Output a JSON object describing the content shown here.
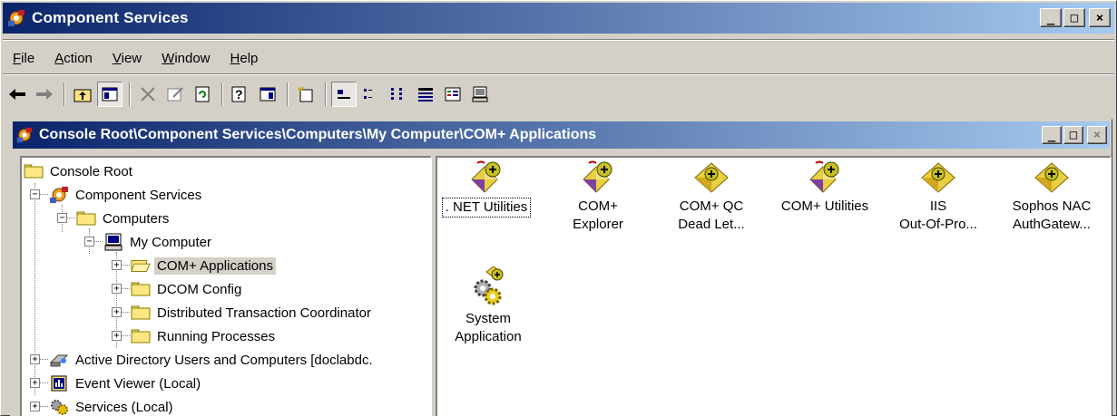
{
  "app": {
    "title": "Component Services"
  },
  "window_buttons": {
    "minimize": "_",
    "maximize": "□",
    "close": "×"
  },
  "menu": [
    {
      "label": "File",
      "key": "F",
      "rest": "ile"
    },
    {
      "label": "Action",
      "key": "A",
      "rest": "ction"
    },
    {
      "label": "View",
      "key": "V",
      "rest": "iew"
    },
    {
      "label": "Window",
      "key": "W",
      "rest": "indow"
    },
    {
      "label": "Help",
      "key": "H",
      "rest": "elp"
    }
  ],
  "toolbar": [
    "back-icon",
    "forward-icon",
    "up-folder-icon",
    "show-hide-tree-icon",
    "delete-icon",
    "properties-icon",
    "refresh-icon",
    "help-icon",
    "show-hide-action-pane-icon",
    "new-icon",
    "large-icons-icon",
    "small-icons-icon",
    "list-view-icon",
    "detail-view-icon",
    "status-view-icon",
    "computer-icon"
  ],
  "mdi": {
    "title": "Console Root\\Component Services\\Computers\\My Computer\\COM+ Applications"
  },
  "tree": [
    {
      "label": "Console Root",
      "icon": "folder-icon",
      "depth": 0
    },
    {
      "label": "Component Services",
      "icon": "component-services-icon",
      "depth": 1,
      "expander": "minus"
    },
    {
      "label": "Computers",
      "icon": "folder-icon",
      "depth": 2,
      "expander": "minus"
    },
    {
      "label": "My Computer",
      "icon": "computer-icon",
      "depth": 3,
      "expander": "minus"
    },
    {
      "label": "COM+ Applications",
      "icon": "open-folder-icon",
      "depth": 4,
      "expander": "plus",
      "selected": true
    },
    {
      "label": "DCOM Config",
      "icon": "folder-icon",
      "depth": 4,
      "expander": "plus"
    },
    {
      "label": "Distributed Transaction Coordinator",
      "icon": "folder-icon",
      "depth": 4,
      "expander": "plus"
    },
    {
      "label": "Running Processes",
      "icon": "folder-icon",
      "depth": 4,
      "expander": "plus"
    },
    {
      "label": "Active Directory Users and Computers [doclabdc.",
      "icon": "active-directory-icon",
      "depth": 1,
      "expander": "plus"
    },
    {
      "label": "Event Viewer (Local)",
      "icon": "event-viewer-icon",
      "depth": 1,
      "expander": "plus"
    },
    {
      "label": "Services (Local)",
      "icon": "services-icon",
      "depth": 1,
      "expander": "plus"
    }
  ],
  "apps": [
    {
      "line1": ". NET Utilities",
      "line2": "",
      "icon": "com-app-running-icon",
      "focused": true
    },
    {
      "line1": "COM+",
      "line2": "Explorer",
      "icon": "com-app-running-icon"
    },
    {
      "line1": "COM+ QC",
      "line2": "Dead Let...",
      "icon": "com-app-icon"
    },
    {
      "line1": "COM+ Utilities",
      "line2": "",
      "icon": "com-app-running-icon"
    },
    {
      "line1": "IIS",
      "line2": "Out-Of-Pro...",
      "icon": "com-app-icon"
    },
    {
      "line1": "Sophos NAC",
      "line2": "AuthGatew...",
      "icon": "com-app-icon"
    },
    {
      "line1": "System",
      "line2": "Application",
      "icon": "system-app-icon"
    }
  ]
}
